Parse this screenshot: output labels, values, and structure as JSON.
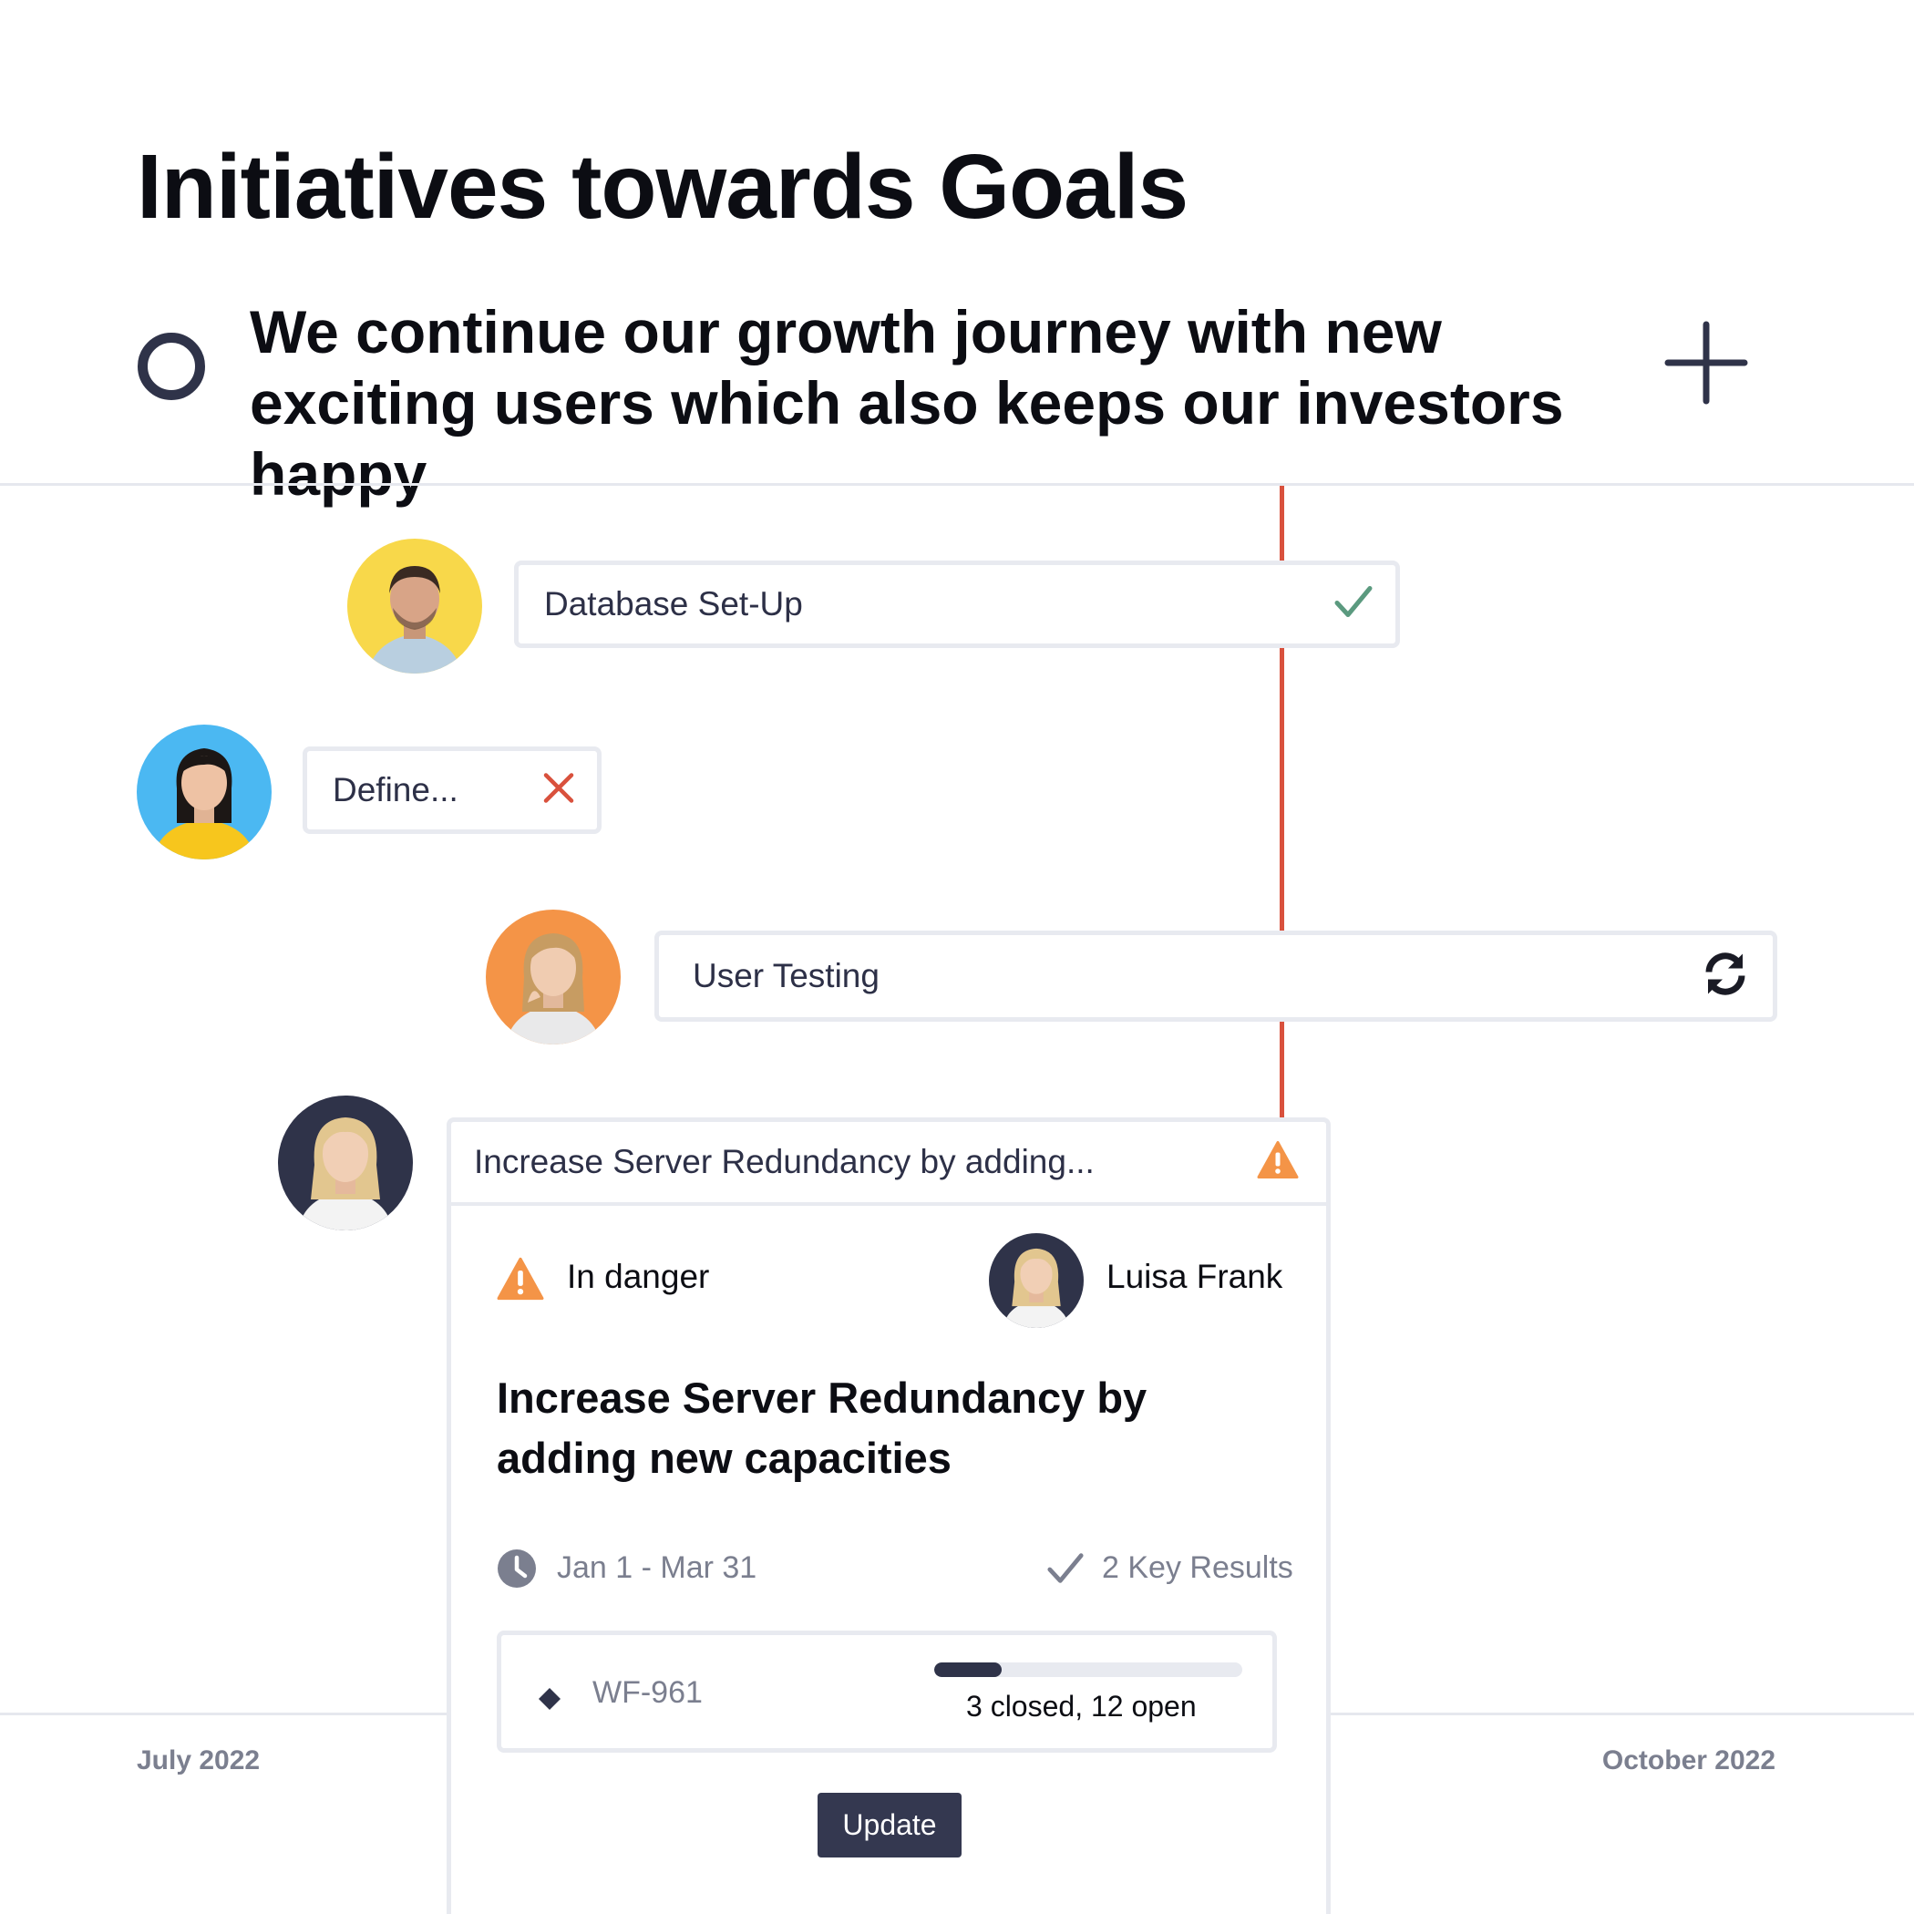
{
  "page": {
    "title": "Initiatives towards Goals"
  },
  "goal": {
    "text": "We continue our growth journey with new exciting users which also keeps our investors happy"
  },
  "initiatives": [
    {
      "label": "Database Set-Up",
      "status": "done",
      "status_icon": "check-icon",
      "status_color": "#5b9a7f",
      "avatar_bg": "#f8d84a"
    },
    {
      "label": "Define...",
      "status": "failed",
      "status_icon": "close-icon",
      "status_color": "#d9513d",
      "avatar_bg": "#4bb8f2"
    },
    {
      "label": "User Testing",
      "status": "in-progress",
      "status_icon": "refresh-icon",
      "status_color": "#1a1b25",
      "avatar_bg": "#f49447"
    },
    {
      "label": "Increase Server Redundancy by adding...",
      "status": "danger",
      "status_icon": "warning-icon",
      "status_color": "#f49447",
      "avatar_bg": "#2f3349"
    }
  ],
  "detail": {
    "status_label": "In danger",
    "owner_name": "Luisa Frank",
    "title": "Increase Server Redundancy by adding new capacities",
    "date_range": "Jan 1 - Mar 31",
    "key_results": "2 Key Results",
    "issue": {
      "key": "WF-961",
      "progress_text": "3 closed, 12 open",
      "closed": 3,
      "open": 12
    },
    "update_label": "Update"
  },
  "timeline": {
    "start_label": "July 2022",
    "end_label": "October 2022"
  },
  "colors": {
    "today_line": "#d9513d",
    "accent_dark": "#2f3349",
    "warning": "#f49447",
    "success": "#5b9a7f"
  }
}
